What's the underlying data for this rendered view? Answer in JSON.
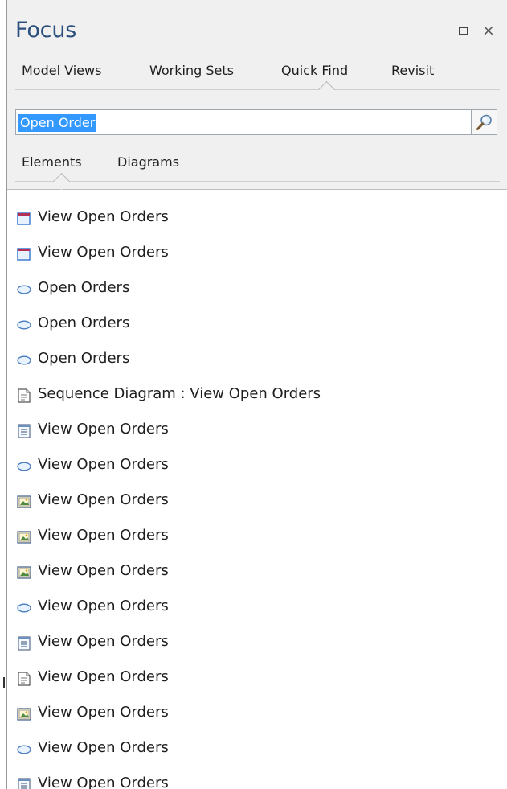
{
  "window": {
    "title": "Focus",
    "restore_icon": "restore-window-icon",
    "close_glyph": "×"
  },
  "tabs": [
    {
      "label": "Model Views"
    },
    {
      "label": "Working Sets"
    },
    {
      "label": "Quick Find",
      "selected": true
    },
    {
      "label": "Revisit"
    }
  ],
  "search": {
    "value": "Open Order",
    "button_icon": "magnifier-icon"
  },
  "subtabs": [
    {
      "label": "Elements",
      "selected": true
    },
    {
      "label": "Diagrams"
    }
  ],
  "results": [
    {
      "label": "View Open Orders",
      "icon": "screen-icon"
    },
    {
      "label": "View Open Orders",
      "icon": "screen-icon"
    },
    {
      "label": "Open Orders",
      "icon": "use-case-icon"
    },
    {
      "label": "Open Orders",
      "icon": "use-case-icon"
    },
    {
      "label": "Open Orders",
      "icon": "use-case-icon"
    },
    {
      "label": "Sequence Diagram : View Open Orders",
      "icon": "diagram-icon"
    },
    {
      "label": "View Open Orders",
      "icon": "form-icon"
    },
    {
      "label": "View Open Orders",
      "icon": "use-case-icon"
    },
    {
      "label": "View Open Orders",
      "icon": "picture-icon"
    },
    {
      "label": "View Open Orders",
      "icon": "picture-icon"
    },
    {
      "label": "View Open Orders",
      "icon": "picture-icon"
    },
    {
      "label": "View Open Orders",
      "icon": "use-case-icon"
    },
    {
      "label": "View Open Orders",
      "icon": "form-icon"
    },
    {
      "label": "View Open Orders",
      "icon": "diagram-icon"
    },
    {
      "label": "View Open Orders",
      "icon": "picture-icon"
    },
    {
      "label": "View Open Orders",
      "icon": "use-case-icon"
    },
    {
      "label": "View Open Orders",
      "icon": "form-icon"
    }
  ]
}
